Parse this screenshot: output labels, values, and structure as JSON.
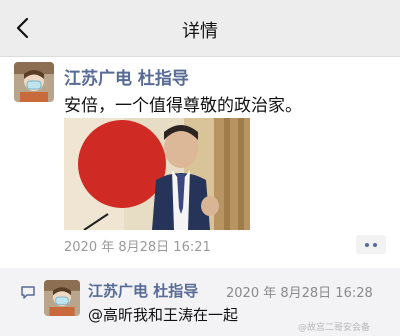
{
  "header": {
    "title": "详情",
    "back_icon": "chevron-left-icon"
  },
  "post": {
    "author": "江苏广电 杜指导",
    "text": "安倍，一个值得尊敬的政治家。",
    "timestamp": "2020 年 8月28日 16:21",
    "more_icon": "ellipsis-icon"
  },
  "comment": {
    "icon": "comment-icon",
    "author": "江苏广电 杜指导",
    "timestamp": "2020 年 8月28日 16:28",
    "text": "@高昕我和王涛在一起"
  },
  "watermark": "@故宫二哥安会备",
  "colors": {
    "link": "#576b95",
    "header_bg": "#ededed",
    "comment_bg": "#f3f3f5"
  }
}
